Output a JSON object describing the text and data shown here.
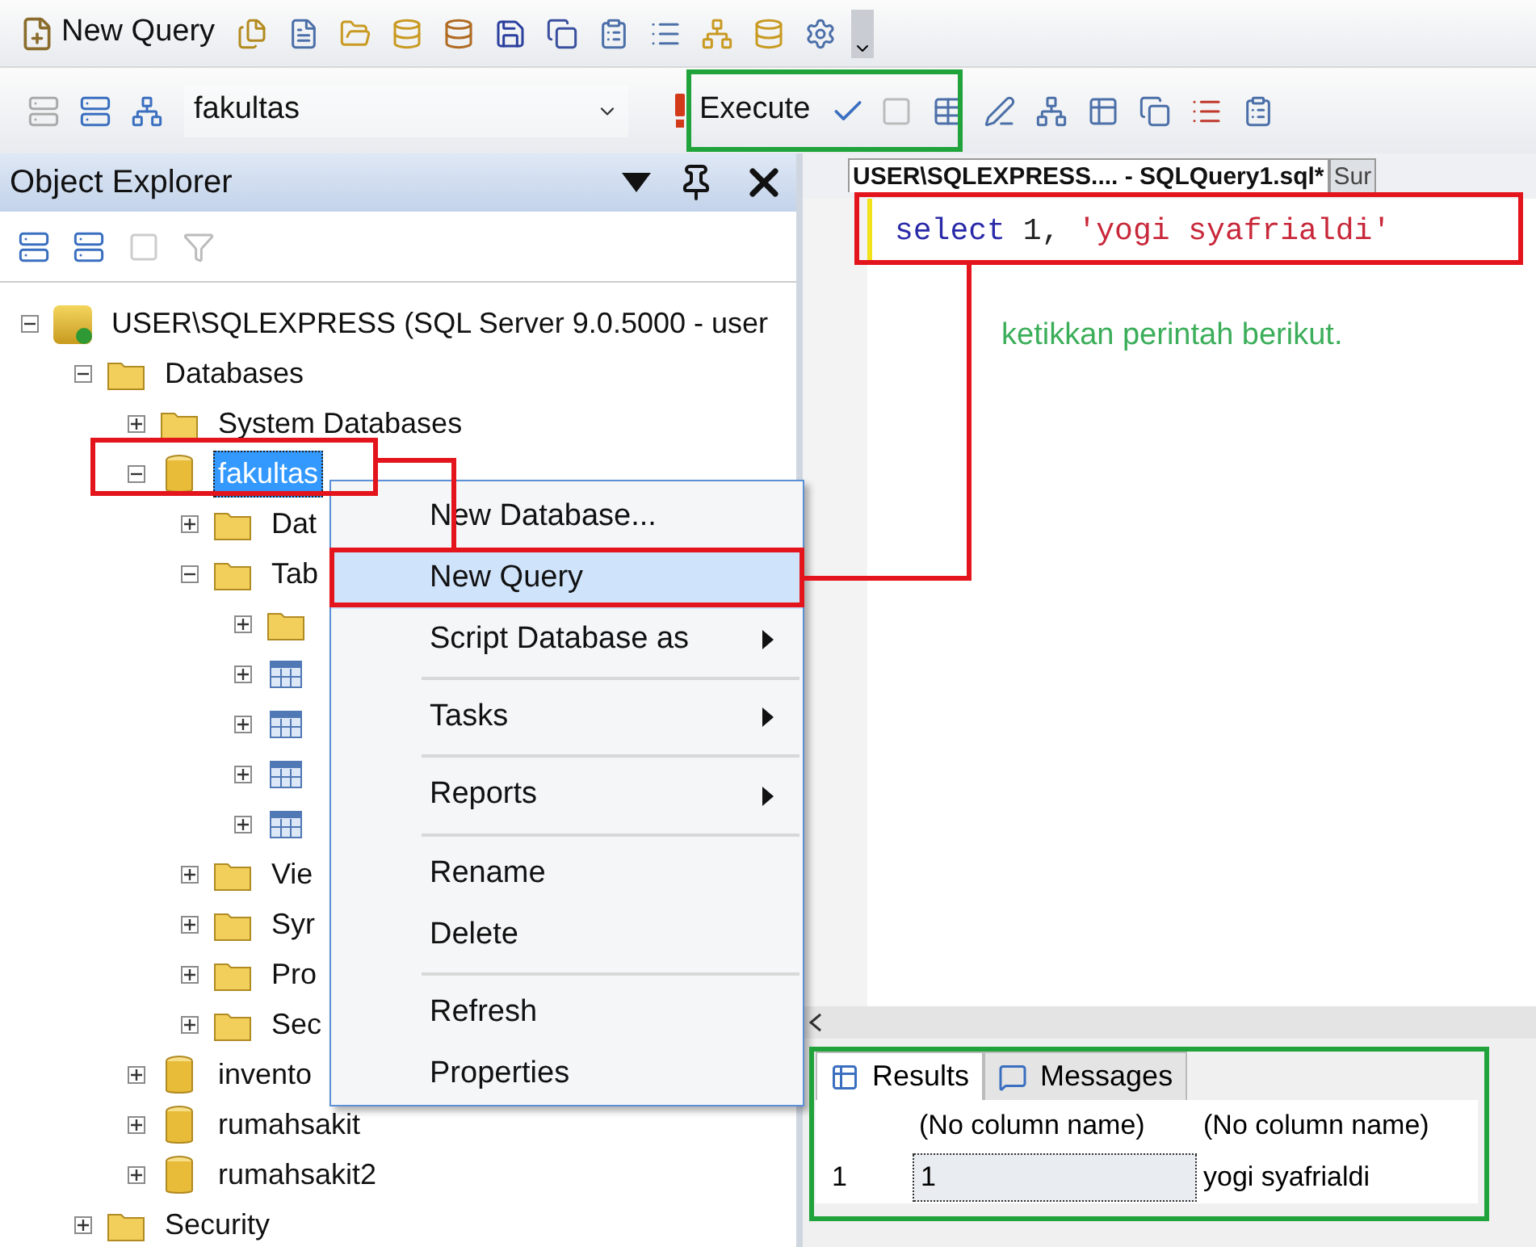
{
  "toolbar": {
    "new_query": "New Query",
    "database": "fakultas",
    "execute": "Execute"
  },
  "object_explorer": {
    "title": "Object Explorer",
    "tree": [
      {
        "kind": "server",
        "label": "USER\\SQLEXPRESS (SQL Server 9.0.5000 - user",
        "expanded": true,
        "selected": false,
        "children": [
          {
            "kind": "folder",
            "label": "Databases",
            "expanded": true,
            "selected": false,
            "children": [
              {
                "kind": "folder",
                "label": "System Databases",
                "expanded": false,
                "selected": false
              },
              {
                "kind": "database",
                "label": "fakultas",
                "expanded": true,
                "selected": true,
                "children": [
                  {
                    "kind": "folder",
                    "label": "Dat",
                    "expanded": false,
                    "selected": false
                  },
                  {
                    "kind": "folder",
                    "label": "Tab",
                    "expanded": true,
                    "selected": false,
                    "children": [
                      {
                        "kind": "folder",
                        "expanded": false,
                        "selected": false
                      },
                      {
                        "kind": "table",
                        "expanded": false,
                        "selected": false
                      },
                      {
                        "kind": "table",
                        "expanded": false,
                        "selected": false
                      },
                      {
                        "kind": "table",
                        "expanded": false,
                        "selected": false
                      },
                      {
                        "kind": "table",
                        "expanded": false,
                        "selected": false
                      }
                    ]
                  },
                  {
                    "kind": "folder",
                    "label": "Vie",
                    "expanded": false,
                    "selected": false
                  },
                  {
                    "kind": "folder",
                    "label": "Syr",
                    "expanded": false,
                    "selected": false
                  },
                  {
                    "kind": "folder",
                    "label": "Pro",
                    "expanded": false,
                    "selected": false
                  },
                  {
                    "kind": "folder",
                    "label": "Sec",
                    "expanded": false,
                    "selected": false
                  }
                ]
              },
              {
                "kind": "database",
                "label": "invento",
                "expanded": false,
                "selected": false
              },
              {
                "kind": "database",
                "label": "rumahsakit",
                "expanded": false,
                "selected": false
              },
              {
                "kind": "database",
                "label": "rumahsakit2",
                "expanded": false,
                "selected": false
              }
            ]
          },
          {
            "kind": "folder",
            "label": "Security",
            "expanded": false,
            "selected": false
          }
        ]
      }
    ]
  },
  "context_menu": [
    {
      "kind": "item",
      "label": "New Database...",
      "selected": false,
      "submenu": false
    },
    {
      "kind": "item",
      "label": "New Query",
      "selected": true,
      "submenu": false
    },
    {
      "kind": "item",
      "label": "Script Database as",
      "selected": false,
      "submenu": true
    },
    {
      "kind": "separator"
    },
    {
      "kind": "item",
      "label": "Tasks",
      "selected": false,
      "submenu": true
    },
    {
      "kind": "separator"
    },
    {
      "kind": "item",
      "label": "Reports",
      "selected": false,
      "submenu": true
    },
    {
      "kind": "separator"
    },
    {
      "kind": "item",
      "label": "Rename",
      "selected": false,
      "submenu": false
    },
    {
      "kind": "item",
      "label": "Delete",
      "selected": false,
      "submenu": false
    },
    {
      "kind": "separator"
    },
    {
      "kind": "item",
      "label": "Refresh",
      "selected": false,
      "submenu": false
    },
    {
      "kind": "item",
      "label": "Properties",
      "selected": false,
      "submenu": false
    }
  ],
  "editor": {
    "tabs": [
      {
        "label": "USER\\SQLEXPRESS.... - SQLQuery1.sql*",
        "selected": true
      },
      {
        "label": "Sur",
        "selected": false
      }
    ],
    "code": [
      {
        "kind": "keyword",
        "text": "select"
      },
      {
        "kind": "plain",
        "text": "1,"
      },
      {
        "kind": "string",
        "text": "'yogi syafrialdi'"
      }
    ]
  },
  "results": {
    "tabs": [
      {
        "label": "Results",
        "selected": true
      },
      {
        "label": "Messages",
        "selected": false
      }
    ],
    "columns": [
      "(No column name)",
      "(No column name)"
    ],
    "rows": [
      {
        "number": "1",
        "cells": [
          "1",
          "yogi syafrialdi"
        ]
      }
    ]
  },
  "annotations": [
    {
      "color": "#1fa33a"
    },
    {
      "color": "#e3141c"
    },
    {
      "color": "#e3141c"
    },
    {
      "color": "#e3141c"
    },
    {
      "color": "#1fa33a"
    }
  ],
  "annotation_note": "ketikkan perintah berikut."
}
